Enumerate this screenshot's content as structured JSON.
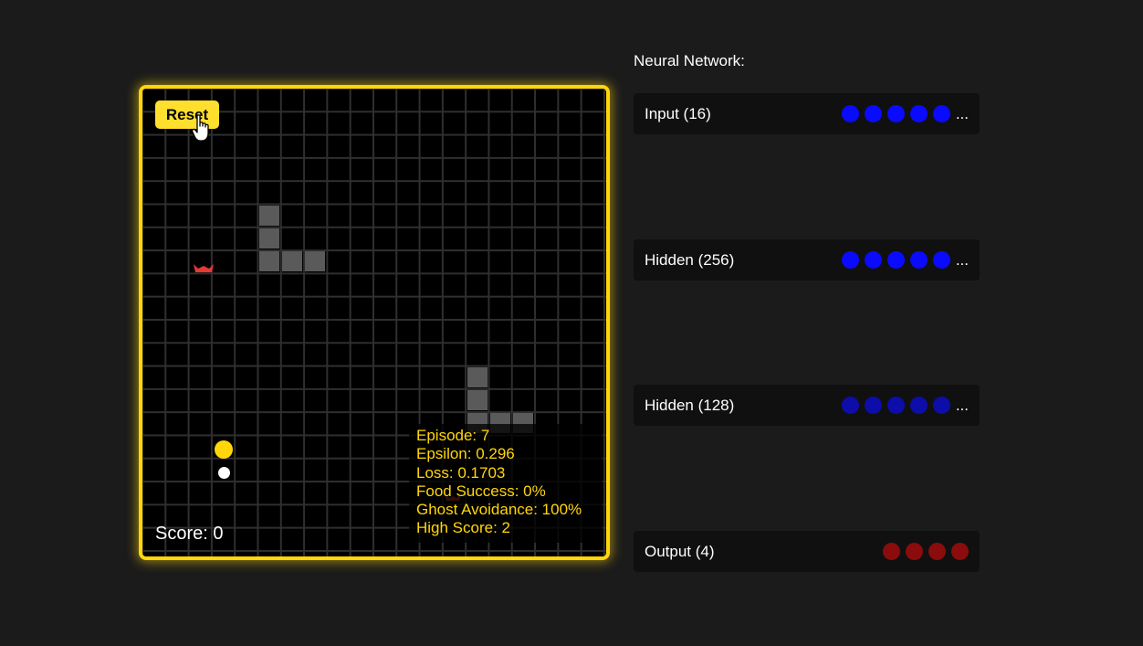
{
  "game": {
    "reset_label": "Reset",
    "score_text": "Score: 0",
    "stats": [
      "Episode: 7",
      "Epsilon: 0.296",
      "Loss: 0.1703",
      "Food Success: 0%",
      "Ghost Avoidance: 100%",
      "High Score: 2"
    ],
    "colors": {
      "border": "#ffd60a",
      "pacman": "#ffd60a",
      "ghost": "#e53935",
      "wall": "#5a5a5a",
      "text": "#ffd60a"
    }
  },
  "network": {
    "title": "Neural Network:",
    "layers": [
      {
        "label": "Input (16)",
        "neuron_color": "#0a0aff",
        "shown_neurons": 5,
        "ellipsis": "..."
      },
      {
        "label": "Hidden (256)",
        "neuron_color": "#0a0aff",
        "shown_neurons": 5,
        "ellipsis": "..."
      },
      {
        "label": "Hidden (128)",
        "neuron_color": "#0d0daa",
        "shown_neurons": 5,
        "ellipsis": "..."
      },
      {
        "label": "Output (4)",
        "neuron_color": "#8b0c0c",
        "shown_neurons": 4,
        "ellipsis": ""
      }
    ]
  },
  "icons": [
    "hand-pointer-icon",
    "ghost-icon",
    "pacman-icon",
    "pellet-icon"
  ]
}
